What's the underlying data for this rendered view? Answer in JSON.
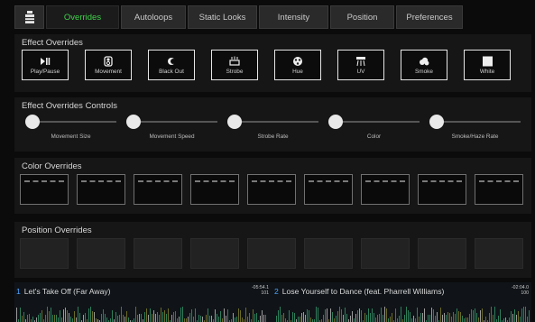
{
  "tabs": [
    {
      "label": "Overrides",
      "active": true
    },
    {
      "label": "Autoloops",
      "active": false
    },
    {
      "label": "Static Looks",
      "active": false
    },
    {
      "label": "Intensity",
      "active": false
    },
    {
      "label": "Position",
      "active": false
    },
    {
      "label": "Preferences",
      "active": false
    }
  ],
  "home_icon": "device-icon",
  "effect_overrides": {
    "title": "Effect Overrides",
    "buttons": [
      {
        "label": "Play/Pause",
        "icon": "play-pause-icon"
      },
      {
        "label": "Movement",
        "icon": "movement-icon"
      },
      {
        "label": "Black Out",
        "icon": "blackout-icon"
      },
      {
        "label": "Strobe",
        "icon": "strobe-icon"
      },
      {
        "label": "Hue",
        "icon": "hue-icon"
      },
      {
        "label": "UV",
        "icon": "uv-icon"
      },
      {
        "label": "Smoke",
        "icon": "smoke-icon"
      },
      {
        "label": "White",
        "icon": "white-icon"
      }
    ]
  },
  "effect_controls": {
    "title": "Effect Overrides Controls",
    "sliders": [
      {
        "label": "Movement Size",
        "value": 0
      },
      {
        "label": "Movement Speed",
        "value": 0
      },
      {
        "label": "Strobe Rate",
        "value": 0
      },
      {
        "label": "Color",
        "value": 0
      },
      {
        "label": "Smoke/Haze Rate",
        "value": 0
      }
    ]
  },
  "color_overrides": {
    "title": "Color Overrides",
    "count": 9
  },
  "position_overrides": {
    "title": "Position Overrides",
    "count": 9
  },
  "decks": [
    {
      "number": "1",
      "title": "Let's Take Off (Far Away)",
      "time": "-05:54.1",
      "bpm": "101"
    },
    {
      "number": "2",
      "title": "Lose Yourself to Dance (feat. Pharrell Williams)",
      "time": "-02:04.0",
      "bpm": "100"
    }
  ],
  "colors": {
    "accent_green": "#3fd14a",
    "deck_blue": "#4aa3ff"
  }
}
